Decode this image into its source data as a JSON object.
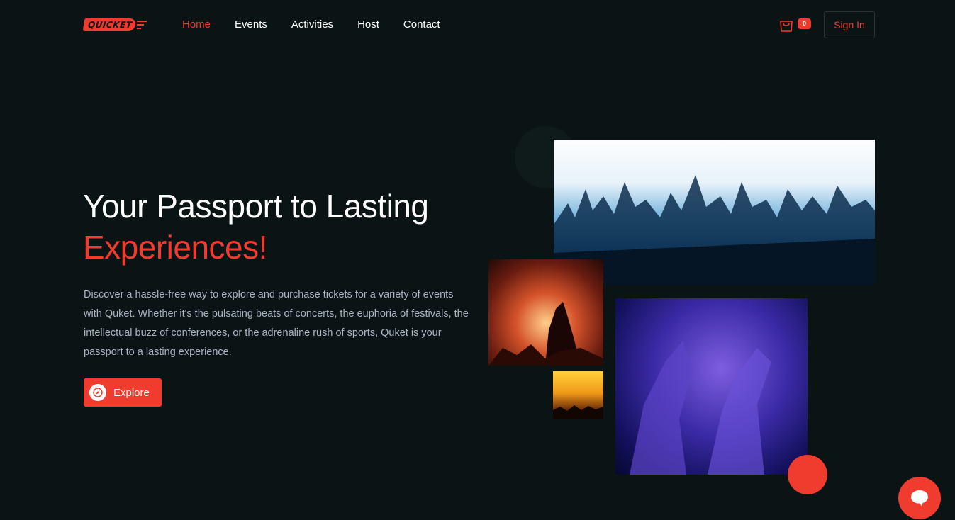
{
  "brand": {
    "logo_text": "QUICKET",
    "accent_color": "#f03c2e",
    "background": "#0a1414"
  },
  "nav": {
    "items": [
      {
        "label": "Home",
        "active": true
      },
      {
        "label": "Events",
        "active": false
      },
      {
        "label": "Activities",
        "active": false
      },
      {
        "label": "Host",
        "active": false
      },
      {
        "label": "Contact",
        "active": false
      }
    ]
  },
  "header": {
    "cart_icon": "shopping-bag-icon",
    "cart_count": "0",
    "signin_label": "Sign In"
  },
  "hero": {
    "title_line1": "Your Passport to Lasting",
    "title_line2": "Experiences!",
    "description": "Discover a hassle-free way to explore and purchase tickets for a variety of events with Quket. Whether it's the pulsating beats of concerts, the euphoria of festivals, the intellectual buzz of conferences, or the adrenaline rush of sports, Quket is your passport to a lasting experience.",
    "explore_label": "Explore",
    "explore_icon": "compass-icon"
  },
  "gallery": {
    "images": [
      {
        "name": "concert-crowd-blue-image"
      },
      {
        "name": "confetti-crowd-image"
      },
      {
        "name": "stage-lights-image"
      },
      {
        "name": "purple-crowd-image"
      }
    ]
  },
  "chat": {
    "icon": "chat-bubble-icon"
  }
}
